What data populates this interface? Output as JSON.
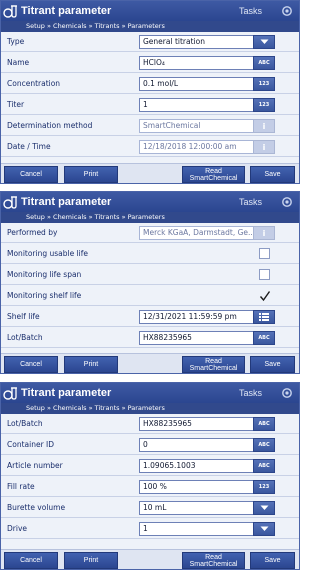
{
  "screens": [
    {
      "title": "Titrant parameter",
      "tasks_label": "Tasks",
      "breadcrumb": "Setup » Chemicals » Titrants » Parameters",
      "rows": [
        {
          "label": "Type",
          "value": "General titration",
          "kind": "dropdown"
        },
        {
          "label": "Name",
          "value": "HClO₄",
          "kind": "text-input",
          "button": "ABC"
        },
        {
          "label": "Concentration",
          "value": "0.1 mol/L",
          "kind": "number-input",
          "button": "123"
        },
        {
          "label": "Titer",
          "value": "1",
          "kind": "number-input",
          "button": "123"
        },
        {
          "label": "Determination method",
          "value": "SmartChemical",
          "kind": "readonly",
          "button": "i"
        },
        {
          "label": "Date / Time",
          "value": "12/18/2018 12:00:00 am",
          "kind": "readonly",
          "button": "i"
        }
      ],
      "footer": {
        "cancel": "Cancel",
        "print": "Print",
        "read_line1": "Read",
        "read_line2": "SmartChemical",
        "save": "Save"
      }
    },
    {
      "title": "Titrant parameter",
      "tasks_label": "Tasks",
      "breadcrumb": "Setup » Chemicals » Titrants » Parameters",
      "rows": [
        {
          "label": "Performed by",
          "value": "Merck KGaA, Darmstadt, Ge...",
          "kind": "readonly",
          "button": "i"
        },
        {
          "label": "Monitoring usable life",
          "kind": "checkbox",
          "checked": false
        },
        {
          "label": "Monitoring life span",
          "kind": "checkbox",
          "checked": false
        },
        {
          "label": "Monitoring shelf life",
          "kind": "checkbox",
          "checked": true
        },
        {
          "label": "Shelf life",
          "value": "12/31/2021 11:59:59 pm",
          "kind": "date-input",
          "button": "list"
        },
        {
          "label": "Lot/Batch",
          "value": "HX88235965",
          "kind": "text-input",
          "button": "ABC"
        }
      ],
      "footer": {
        "cancel": "Cancel",
        "print": "Print",
        "read_line1": "Read",
        "read_line2": "SmartChemical",
        "save": "Save"
      }
    },
    {
      "title": "Titrant parameter",
      "tasks_label": "Tasks",
      "breadcrumb": "Setup » Chemicals » Titrants » Parameters",
      "rows": [
        {
          "label": "Lot/Batch",
          "value": "HX88235965",
          "kind": "text-input",
          "button": "ABC"
        },
        {
          "label": "Container ID",
          "value": "0",
          "kind": "text-input",
          "button": "ABC"
        },
        {
          "label": "Article number",
          "value": "1.09065.1003",
          "kind": "text-input",
          "button": "ABC"
        },
        {
          "label": "Fill rate",
          "value": "100 %",
          "kind": "number-input",
          "button": "123"
        },
        {
          "label": "Burette volume",
          "value": "10 mL",
          "kind": "dropdown"
        },
        {
          "label": "Drive",
          "value": "1",
          "kind": "dropdown"
        }
      ],
      "footer": {
        "cancel": "Cancel",
        "print": "Print",
        "read_line1": "Read",
        "read_line2": "SmartChemical",
        "save": "Save"
      }
    }
  ],
  "colors": {
    "titlebar": "#2b4690",
    "breadcrumb": "#31498c",
    "body": "#eef2f9",
    "button": "#3a579e",
    "label_text": "#1a2e6c"
  },
  "icons": {
    "title": "titrator-flask-icon",
    "gear": "gear-icon",
    "dropdown": "chevron-down-icon",
    "calendar": "list-picker-icon",
    "check": "checkmark-icon"
  }
}
